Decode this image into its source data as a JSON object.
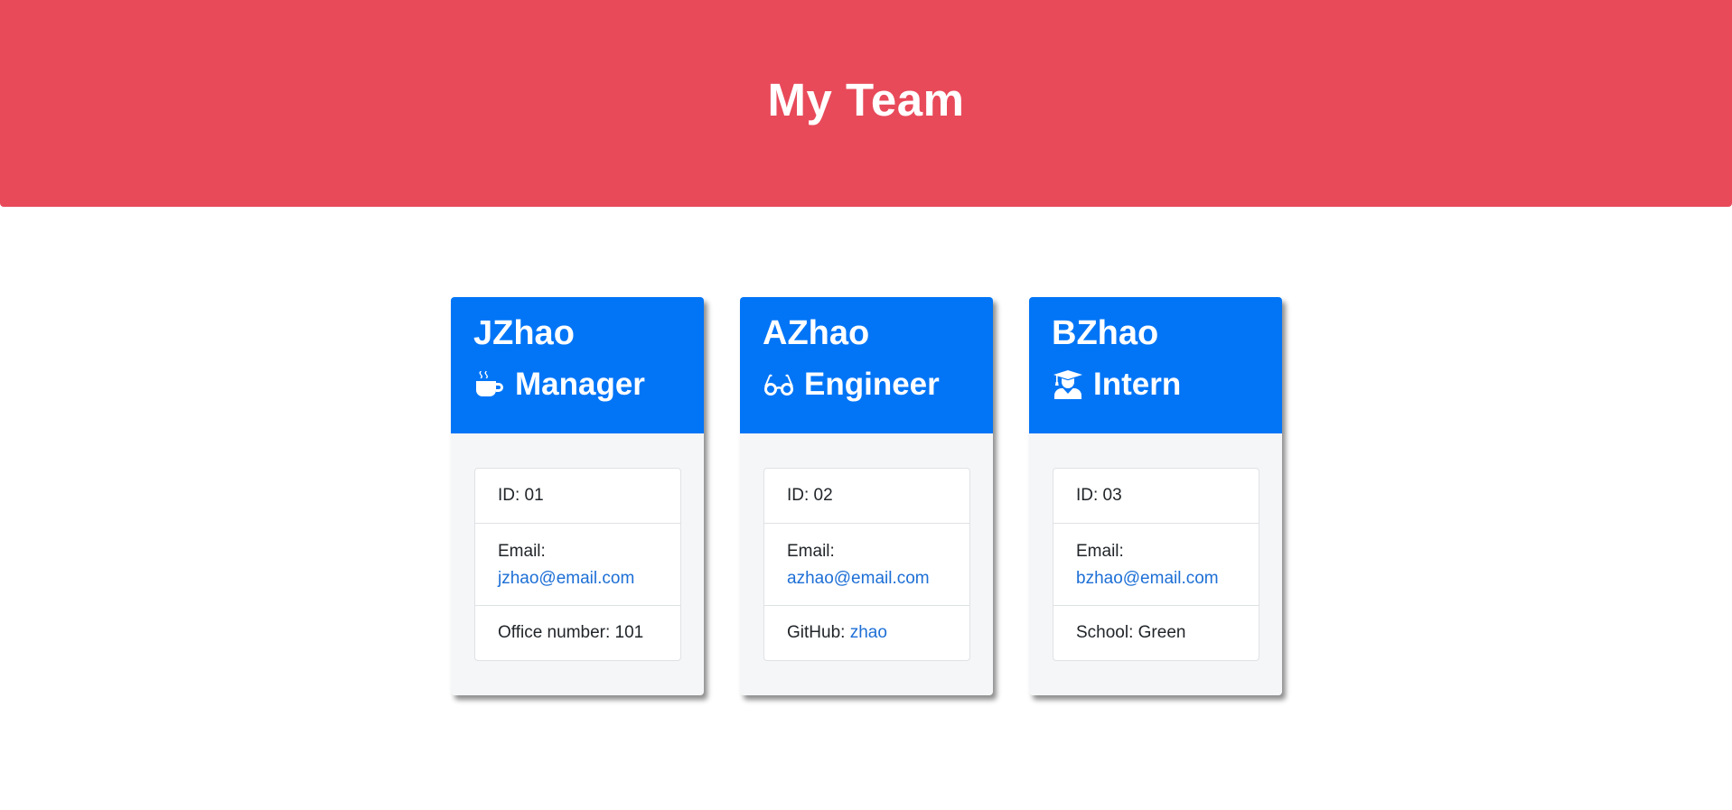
{
  "header": {
    "title": "My Team"
  },
  "employees": [
    {
      "name": "JZhao",
      "role": "Manager",
      "role_icon": "coffee-icon",
      "id_label": "ID: 01",
      "email_label": "Email:",
      "email": "jzhao@email.com",
      "extra_label": "Office number: 101",
      "extra_link": ""
    },
    {
      "name": "AZhao",
      "role": "Engineer",
      "role_icon": "glasses-icon",
      "id_label": "ID: 02",
      "email_label": "Email:",
      "email": "azhao@email.com",
      "extra_label": "GitHub: ",
      "extra_link": "zhao"
    },
    {
      "name": "BZhao",
      "role": "Intern",
      "role_icon": "graduate-icon",
      "id_label": "ID: 03",
      "email_label": "Email:",
      "email": "bzhao@email.com",
      "extra_label": "School: Green",
      "extra_link": ""
    }
  ],
  "colors": {
    "header_bg": "#e84a5a",
    "card_header_bg": "#0275f6",
    "link": "#1d6fd6"
  }
}
